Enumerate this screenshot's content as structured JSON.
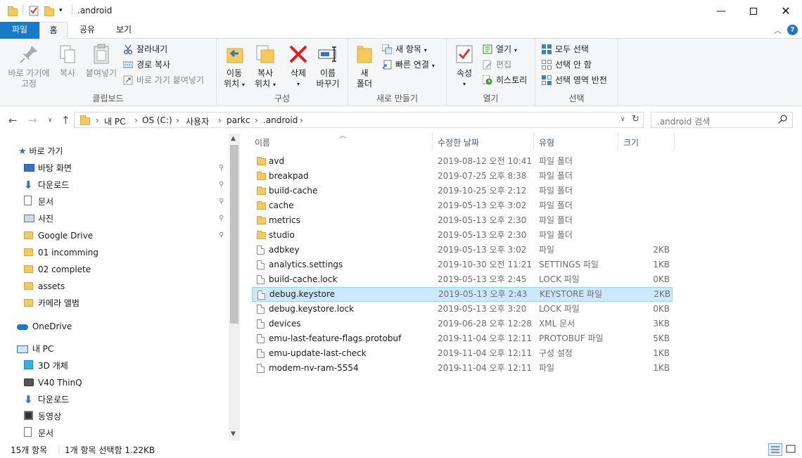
{
  "window": {
    "title": ".android",
    "controls": [
      "minimize-icon",
      "maximize-icon",
      "close-icon"
    ]
  },
  "ribbon_tabs": [
    {
      "label": "파일"
    },
    {
      "label": "홈"
    },
    {
      "label": "공유"
    },
    {
      "label": "보기"
    }
  ],
  "ribbon": {
    "clipboard": {
      "label": "클립보드",
      "pin_label_1": "바로 가기에",
      "pin_label_2": "고정",
      "copy": "복사",
      "paste": "붙여넣기",
      "cut": "잘라내기",
      "copy_path": "경로 복사",
      "paste_shortcut": "바로 가기 붙여넣기"
    },
    "organize": {
      "label": "구성",
      "move_1": "이동",
      "move_2": "위치",
      "copy_1": "복사",
      "copy_2": "위치",
      "delete": "삭제",
      "rename_1": "이름",
      "rename_2": "바꾸기"
    },
    "new": {
      "label": "새로 만들기",
      "folder_1": "새",
      "folder_2": "폴더",
      "new_item": "새 항목",
      "easy_access": "빠른 연결"
    },
    "open": {
      "label": "열기",
      "properties": "속성",
      "open": "열기",
      "edit": "편집",
      "history": "히스토리"
    },
    "select": {
      "label": "선택",
      "select_all": "모두 선택",
      "select_none": "선택 안 함",
      "invert": "선택 영역 반전"
    }
  },
  "address": {
    "breadcrumbs": [
      "내 PC",
      "OS (C:)",
      "사용자",
      "parkc",
      ".android"
    ],
    "search_placeholder": ".android 검색"
  },
  "nav": {
    "quick_access": "바로 가기",
    "items": [
      {
        "label": "바탕 화면",
        "icon": "desktop-icon",
        "pinned": true
      },
      {
        "label": "다운로드",
        "icon": "download-icon",
        "pinned": true
      },
      {
        "label": "문서",
        "icon": "document-icon",
        "pinned": true
      },
      {
        "label": "사진",
        "icon": "pictures-icon",
        "pinned": true
      },
      {
        "label": "Google Drive",
        "icon": "folder-icon",
        "pinned": true
      },
      {
        "label": "01 incomming",
        "icon": "folder-icon",
        "pinned": false
      },
      {
        "label": "02 complete",
        "icon": "folder-icon",
        "pinned": false
      },
      {
        "label": "assets",
        "icon": "folder-icon",
        "pinned": false
      },
      {
        "label": "카메라 앨범",
        "icon": "folder-icon",
        "pinned": false
      }
    ],
    "onedrive": "OneDrive",
    "this_pc": "내 PC",
    "pc_items": [
      {
        "label": "3D 개체",
        "icon": "3d-objects-icon"
      },
      {
        "label": "V40 ThinQ",
        "icon": "phone-icon"
      },
      {
        "label": "다운로드",
        "icon": "download-icon"
      },
      {
        "label": "동영상",
        "icon": "video-icon"
      },
      {
        "label": "문서",
        "icon": "document-icon"
      }
    ]
  },
  "columns": {
    "name": "이름",
    "date": "수정한 날짜",
    "type": "유형",
    "size": "크기"
  },
  "files": [
    {
      "name": "avd",
      "date": "2019-08-12 오전 10:41",
      "type": "파일 폴더",
      "size": "",
      "kind": "folder"
    },
    {
      "name": "breakpad",
      "date": "2019-07-25 오후 8:38",
      "type": "파일 폴더",
      "size": "",
      "kind": "folder"
    },
    {
      "name": "build-cache",
      "date": "2019-10-25 오후 2:12",
      "type": "파일 폴더",
      "size": "",
      "kind": "folder"
    },
    {
      "name": "cache",
      "date": "2019-05-13 오후 3:02",
      "type": "파일 폴더",
      "size": "",
      "kind": "folder"
    },
    {
      "name": "metrics",
      "date": "2019-05-13 오후 2:30",
      "type": "파일 폴더",
      "size": "",
      "kind": "folder"
    },
    {
      "name": "studio",
      "date": "2019-05-13 오후 2:30",
      "type": "파일 폴더",
      "size": "",
      "kind": "folder"
    },
    {
      "name": "adbkey",
      "date": "2019-05-13 오후 3:02",
      "type": "파일",
      "size": "2KB",
      "kind": "file"
    },
    {
      "name": "analytics.settings",
      "date": "2019-10-30 오전 11:21",
      "type": "SETTINGS 파일",
      "size": "1KB",
      "kind": "file"
    },
    {
      "name": "build-cache.lock",
      "date": "2019-05-13 오후 2:45",
      "type": "LOCK 파일",
      "size": "0KB",
      "kind": "file"
    },
    {
      "name": "debug.keystore",
      "date": "2019-05-13 오후 2:43",
      "type": "KEYSTORE 파일",
      "size": "2KB",
      "kind": "file",
      "selected": true
    },
    {
      "name": "debug.keystore.lock",
      "date": "2019-05-13 오후 3:20",
      "type": "LOCK 파일",
      "size": "0KB",
      "kind": "file"
    },
    {
      "name": "devices",
      "date": "2019-06-28 오후 12:28",
      "type": "XML 문서",
      "size": "3KB",
      "kind": "file"
    },
    {
      "name": "emu-last-feature-flags.protobuf",
      "date": "2019-11-04 오후 12:11",
      "type": "PROTOBUF 파일",
      "size": "5KB",
      "kind": "file"
    },
    {
      "name": "emu-update-last-check",
      "date": "2019-11-04 오후 12:11",
      "type": "구성 설정",
      "size": "1KB",
      "kind": "config"
    },
    {
      "name": "modem-nv-ram-5554",
      "date": "2019-11-04 오후 12:11",
      "type": "파일",
      "size": "1KB",
      "kind": "file"
    }
  ],
  "status": {
    "count": "15개 항목",
    "selection": "1개 항목 선택함 1.22KB"
  },
  "colors": {
    "accent": "#1979ca",
    "selection": "#cce8ff",
    "folder": "#f4c95d"
  }
}
